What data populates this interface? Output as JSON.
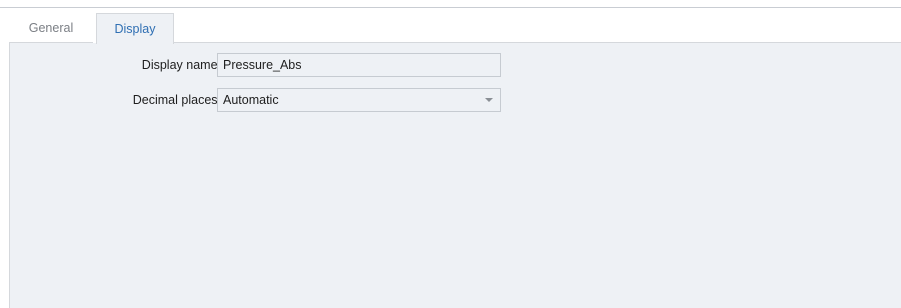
{
  "tabs": [
    {
      "label": "General",
      "active": false
    },
    {
      "label": "Display",
      "active": true
    }
  ],
  "form": {
    "display_name": {
      "label": "Display name:",
      "value": "Pressure_Abs"
    },
    "decimal_places": {
      "label": "Decimal places:",
      "value": "Automatic"
    }
  },
  "colors": {
    "active_tab_text": "#2f6fb3",
    "inactive_tab_text": "#7b7f85",
    "panel_background": "#eef1f5",
    "border": "#d5d8dc"
  },
  "icons": {
    "dropdown": "chevron-down-icon"
  }
}
